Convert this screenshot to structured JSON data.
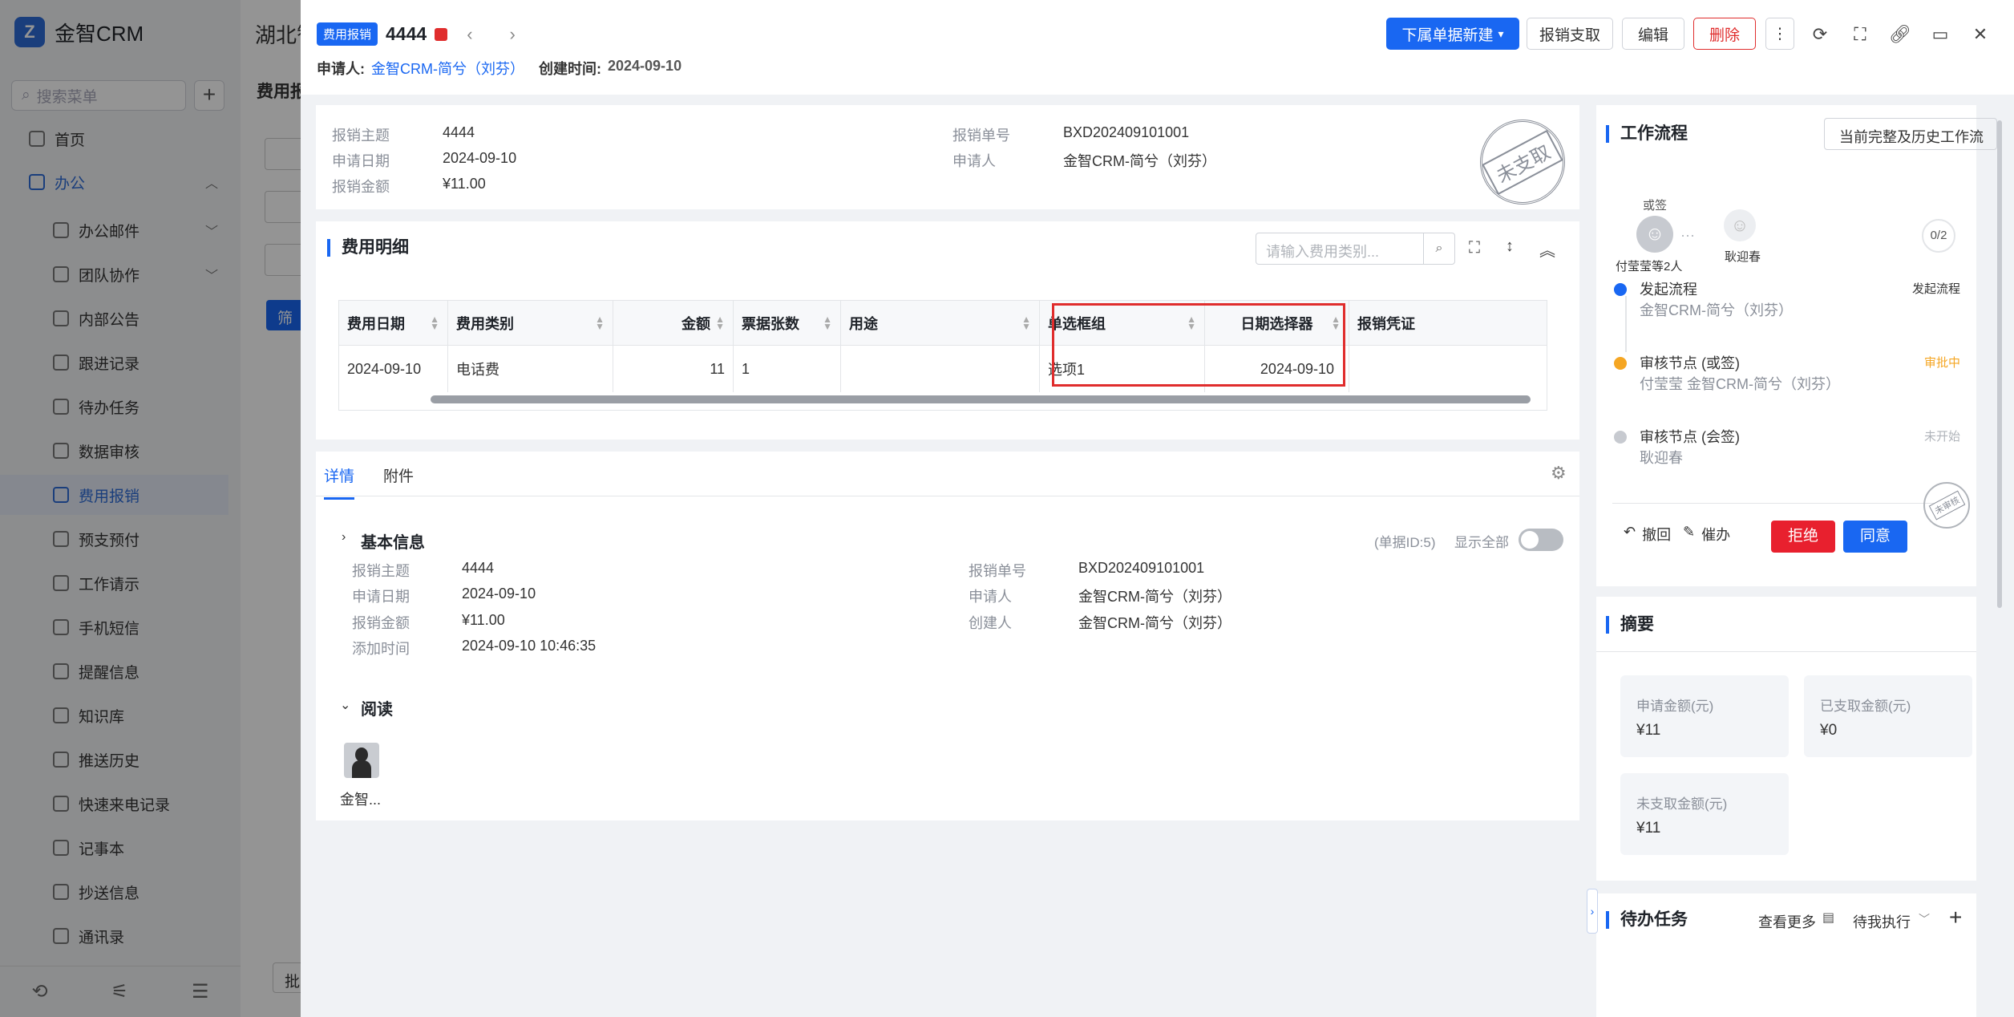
{
  "app": {
    "name": "金智CRM"
  },
  "sidebar": {
    "search_placeholder": "搜索菜单",
    "items": [
      {
        "label": "首页"
      },
      {
        "label": "办公"
      },
      {
        "label": "办公邮件"
      },
      {
        "label": "团队协作"
      },
      {
        "label": "内部公告"
      },
      {
        "label": "跟进记录"
      },
      {
        "label": "待办任务"
      },
      {
        "label": "数据审核"
      },
      {
        "label": "费用报销"
      },
      {
        "label": "预支预付"
      },
      {
        "label": "工作请示"
      },
      {
        "label": "手机短信"
      },
      {
        "label": "提醒信息"
      },
      {
        "label": "知识库"
      },
      {
        "label": "推送历史"
      },
      {
        "label": "快速来电记录"
      },
      {
        "label": "记事本"
      },
      {
        "label": "抄送信息"
      },
      {
        "label": "通讯录"
      }
    ]
  },
  "background": {
    "company": "湖北智",
    "page_title": "费用报",
    "filter_btn": "筛",
    "batch_btn": "批"
  },
  "header": {
    "tag": "费用报销",
    "record_title": "4444",
    "applicant_label": "申请人:",
    "applicant": "金智CRM-简兮（刘芬）",
    "created_label": "创建时间:",
    "created": "2024-09-10",
    "buttons": {
      "new_sub": "下属单据新建",
      "pay": "报销支取",
      "edit": "编辑",
      "delete": "删除"
    }
  },
  "summary_card": {
    "left": [
      {
        "label": "报销主题",
        "value": "4444"
      },
      {
        "label": "申请日期",
        "value": "2024-09-10"
      },
      {
        "label": "报销金额",
        "value": "¥11.00"
      }
    ],
    "right": [
      {
        "label": "报销单号",
        "value": "BXD202409101001"
      },
      {
        "label": "申请人",
        "value": "金智CRM-简兮（刘芬）"
      }
    ],
    "stamp": "未支取"
  },
  "expense_detail": {
    "title": "费用明细",
    "search_placeholder": "请输入费用类别...",
    "columns": [
      "费用日期",
      "费用类别",
      "金额",
      "票据张数",
      "用途",
      "单选框组",
      "日期选择器",
      "报销凭证"
    ],
    "rows": [
      [
        "2024-09-10",
        "电话费",
        "11",
        "1",
        "",
        "选项1",
        "2024-09-10",
        ""
      ]
    ]
  },
  "tabs": {
    "items": [
      "详情",
      "附件"
    ],
    "active": 0
  },
  "basic_info": {
    "title": "基本信息",
    "doc_id": "(单据ID:5)",
    "show_all": "显示全部",
    "left": [
      {
        "label": "报销主题",
        "value": "4444"
      },
      {
        "label": "申请日期",
        "value": "2024-09-10"
      },
      {
        "label": "报销金额",
        "value": "¥11.00"
      },
      {
        "label": "添加时间",
        "value": "2024-09-10 10:46:35"
      }
    ],
    "right": [
      {
        "label": "报销单号",
        "value": "BXD202409101001"
      },
      {
        "label": "申请人",
        "value": "金智CRM-简兮（刘芬）"
      },
      {
        "label": "创建人",
        "value": "金智CRM-简兮（刘芬）"
      }
    ]
  },
  "read": {
    "title": "阅读",
    "reader": "金智..."
  },
  "workflow": {
    "title": "工作流程",
    "history_btn": "当前完整及历史工作流",
    "or_sign": "或签",
    "approver_group": "付莹莹等2人",
    "next_approver": "耿迎春",
    "progress": "0/2",
    "nodes": [
      {
        "title": "发起流程",
        "person": "金智CRM-简兮（刘芬）",
        "status": "发起流程",
        "status_color": "#333333"
      },
      {
        "title": "审核节点 (或签)",
        "person": "付莹莹 金智CRM-简兮（刘芬）",
        "status": "审批中",
        "status_color": "#f5a623"
      },
      {
        "title": "审核节点 (会签)",
        "person": "耿迎春",
        "status": "未开始",
        "status_color": "#b0b4ba"
      }
    ],
    "actions": {
      "revoke": "撤回",
      "urge": "催办",
      "reject": "拒绝",
      "approve": "同意"
    },
    "stamp": "未审核"
  },
  "abstract": {
    "title": "摘要",
    "items": [
      {
        "label": "申请金额(元)",
        "value": "¥11"
      },
      {
        "label": "已支取金额(元)",
        "value": "¥0"
      },
      {
        "label": "未支取金额(元)",
        "value": "¥11"
      }
    ]
  },
  "todo": {
    "title": "待办任务",
    "more": "查看更多",
    "filter": "待我执行"
  },
  "colors": {
    "accent": "#1967f2",
    "danger": "#e02d2d",
    "highlight_box": "#e02d2d"
  }
}
